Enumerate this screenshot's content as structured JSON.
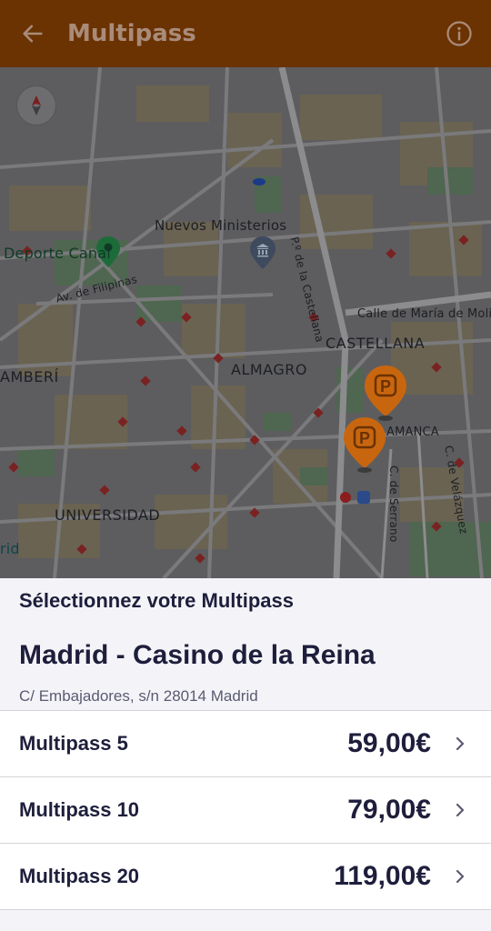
{
  "colors": {
    "appbar_bg": "#6b3202",
    "appbar_text": "#a98b79",
    "pin": "#c8660f",
    "text_primary": "#1e1e3c",
    "text_secondary": "#5a5a72",
    "sheet_bg": "#f4f4f8"
  },
  "appbar": {
    "title": "Multipass",
    "back_icon": "arrow-left-icon",
    "info_icon": "info-circle-icon"
  },
  "map": {
    "labels": {
      "nuevos_ministerios": "Nuevos Ministerios",
      "deporte_canal": "Deporte Canal",
      "castellana": "CASTELLANA",
      "almagro": "ALMAGRO",
      "chamberi": "AMBERÍ",
      "universidad": "UNIVERSIDAD",
      "salamanca": "AMANCA",
      "maria_molina": "Calle de María de Molina",
      "av_filipinas": "Av. de Filipinas",
      "castellana_street": "P.º de la Castellana",
      "serrano": "C. de Serrano",
      "velazquez": "C. de Velázquez",
      "edge_rid": "rid"
    },
    "icons": [
      "compass-icon",
      "parking-pin-icon",
      "metro-icon",
      "museum-pin-icon",
      "green-pin-icon"
    ]
  },
  "sheet": {
    "select_title": "Sélectionnez votre Multipass",
    "place_name": "Madrid - Casino de la Reina",
    "address": "C/ Embajadores, s/n 28014 Madrid",
    "options": [
      {
        "name": "Multipass 5",
        "price": "59,00€"
      },
      {
        "name": "Multipass 10",
        "price": "79,00€"
      },
      {
        "name": "Multipass 20",
        "price": "119,00€"
      }
    ]
  }
}
